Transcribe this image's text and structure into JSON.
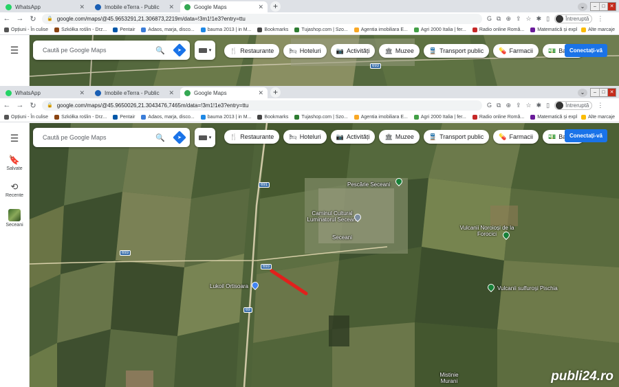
{
  "browsers": [
    {
      "tabs": [
        {
          "title": "WhatsApp",
          "fav_color": "#25d366",
          "active": false
        },
        {
          "title": "Imobile eTerra - Public",
          "fav_color": "#1a5fb4",
          "active": false
        },
        {
          "title": "Google Maps",
          "fav_color": "#34a853",
          "active": true
        }
      ],
      "url": "google.com/maps/@45.9653291,21.306873,2219m/data=!3m1!1e3?entry=ttu"
    },
    {
      "tabs": [
        {
          "title": "WhatsApp",
          "fav_color": "#25d366",
          "active": false
        },
        {
          "title": "Imobile eTerra - Public",
          "fav_color": "#1a5fb4",
          "active": false
        },
        {
          "title": "Google Maps",
          "fav_color": "#34a853",
          "active": true
        }
      ],
      "url": "google.com/maps/@45.9650026,21.3043476,7465m/data=!3m1!1e3?entry=ttu"
    }
  ],
  "profile_label": "Întreruptă",
  "bookmarks": [
    {
      "label": "Opțiuni - În culise",
      "color": "#555555"
    },
    {
      "label": "Szkółka roślin - Drz...",
      "color": "#8b4513"
    },
    {
      "label": "Pentair",
      "color": "#0057a8"
    },
    {
      "label": "Adaos, marja, disco...",
      "color": "#3b7dd8"
    },
    {
      "label": "bauma 2013 | in M...",
      "color": "#1e88e5"
    },
    {
      "label": "Bookmarks",
      "color": "#444444"
    },
    {
      "label": "Tujashop.com | Szo...",
      "color": "#2e7d32"
    },
    {
      "label": "Agentia imobiliara E...",
      "color": "#f9a825"
    },
    {
      "label": "Agri 2000 Italia | fer...",
      "color": "#43a047"
    },
    {
      "label": "Radio online Româ...",
      "color": "#c62828"
    },
    {
      "label": "Matematică și expl...",
      "color": "#6a1b9a"
    }
  ],
  "bookmarks_other": "Alte marcaje",
  "maps": {
    "search_placeholder": "Caută pe Google Maps",
    "chips": [
      {
        "label": "Restaurante",
        "icon": "🍴"
      },
      {
        "label": "Hoteluri",
        "icon": "🛏"
      },
      {
        "label": "Activități",
        "icon": "📷"
      },
      {
        "label": "Muzee",
        "icon": "🏛"
      },
      {
        "label": "Transport public",
        "icon": "🚆"
      },
      {
        "label": "Farmacii",
        "icon": "💊"
      },
      {
        "label": "Ban",
        "icon": "💵"
      }
    ],
    "signin_label": "Conectați-vă",
    "sidebar": {
      "saved": "Salvate",
      "recent": "Recente",
      "place": "Seceani"
    },
    "labels": {
      "pescarie": "Pescărie Seceani",
      "caminul": "Caminul Cultural Luminatorul Seceani",
      "seceani": "Seceani",
      "vulcanii_norosi": "Vulcanii Noroioși de la Forocici",
      "vulcanii_sulfurosi": "Vulcanii sulfuroși Pischia",
      "lukoil": "Lukoil Ortisoara",
      "mistinie": "Mistinie Murani",
      "road_693": "693",
      "road_691": "691",
      "road_69": "69"
    }
  },
  "watermark": "publi24.ro"
}
